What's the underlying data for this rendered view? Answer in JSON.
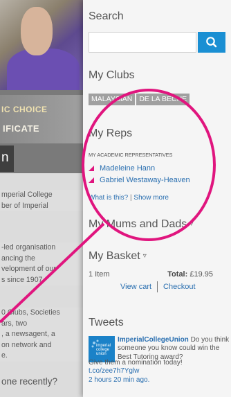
{
  "background_page": {
    "banner_line1": "IC CHOICE",
    "banner_line2": "IFICATE",
    "banner_dark_text": "n",
    "text_block1": [
      "mperial College",
      "ber of Imperial"
    ],
    "text_block2": [
      "-led organisation",
      "ancing the",
      "velopment of our",
      "s since 1907."
    ],
    "text_block3": [
      "0 Clubs, Societies",
      "ars, two",
      ", a newsagent, a",
      "on network and",
      "e."
    ],
    "heading": "one recently?"
  },
  "sidebar": {
    "search": {
      "title": "Search",
      "placeholder": "",
      "icon": "search-icon",
      "button_color": "#1a8fd3"
    },
    "clubs": {
      "title": "My Clubs",
      "tags": [
        "MALAYSIAN",
        "DE LA BECHE"
      ]
    },
    "reps": {
      "title": "My Reps",
      "subtitle": "MY ACADEMIC REPRESENTATIVES",
      "people": [
        "Madeleine Hann",
        "Gabriel Westaway-Heaven"
      ],
      "bullet_color": "#e0157e",
      "what_link": "What is this?",
      "separator": "|",
      "more_link": "Show more"
    },
    "mums_dads": {
      "title": "My Mums and Dads",
      "caret": "▿"
    },
    "basket": {
      "title": "My Basket",
      "caret": "▿",
      "items": "1 Item",
      "total_label": "Total:",
      "total_value": "£19.95",
      "view_cart": "View cart",
      "checkout": "Checkout"
    },
    "tweets": {
      "title": "Tweets",
      "avatar_lines": [
        "imperial",
        "college",
        "union"
      ],
      "author": "ImperialCollegeUnion",
      "text": "Do you think someone you know could win the Best Tutoring award?",
      "text2": "Give them a nomination today!",
      "link": "t.co/zee7h7Yglw",
      "time": "2 hours 20 min ago."
    }
  },
  "annotation": {
    "color": "#e0157e"
  }
}
